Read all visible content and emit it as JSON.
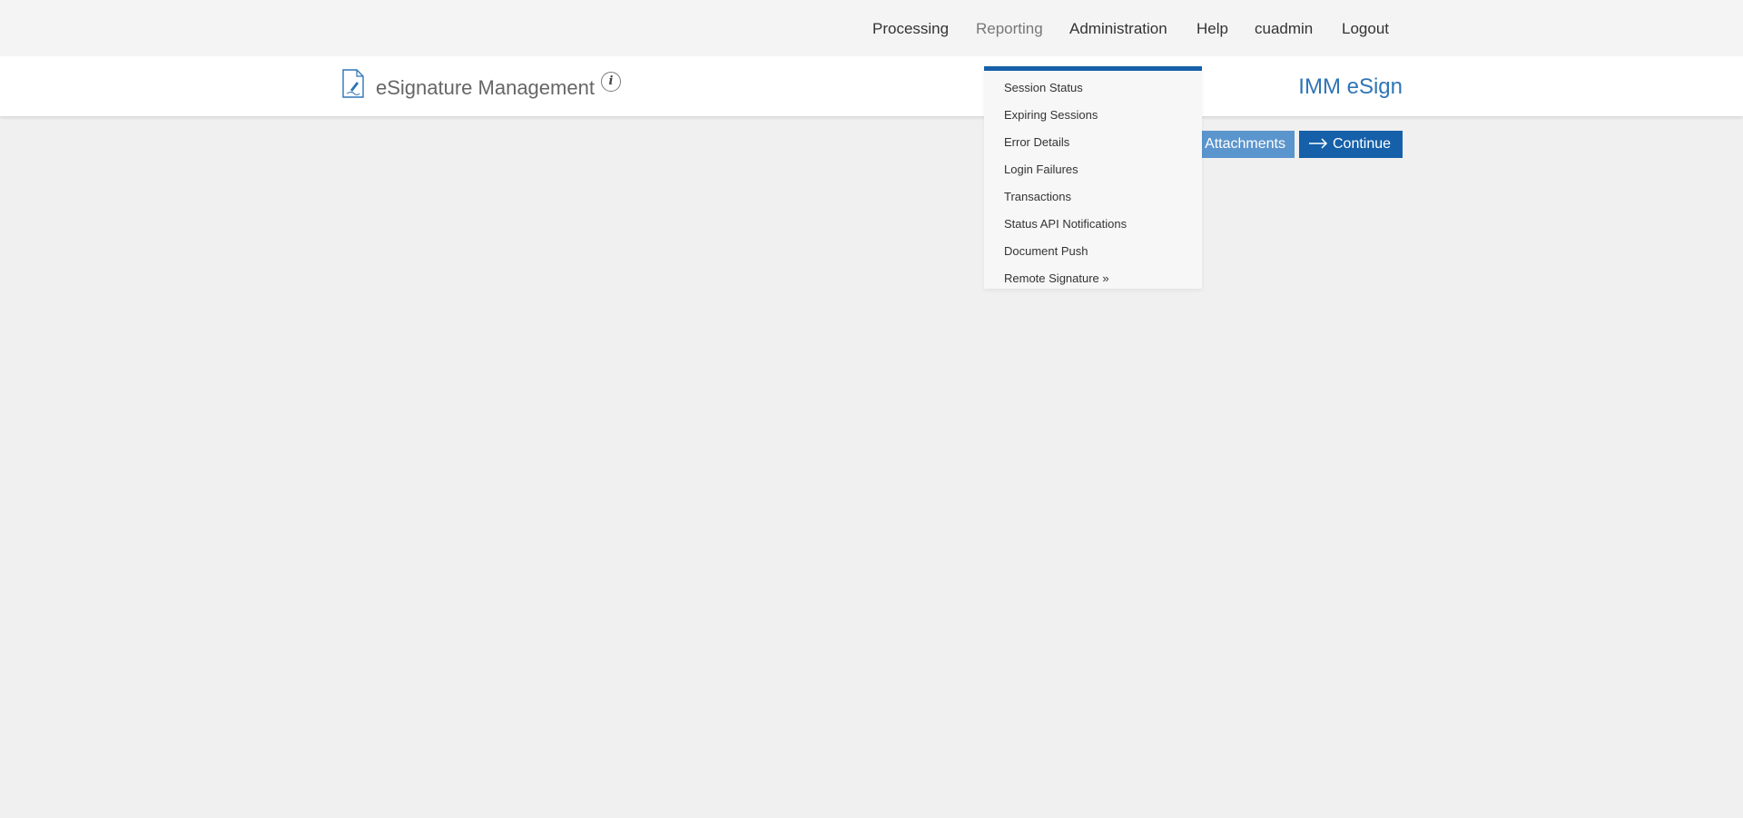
{
  "topnav": {
    "items": [
      {
        "label": "Processing"
      },
      {
        "label": "Reporting"
      },
      {
        "label": "Administration"
      },
      {
        "label": "Help"
      },
      {
        "label": "cuadmin"
      },
      {
        "label": "Logout"
      }
    ],
    "active": "Reporting"
  },
  "header": {
    "title": "eSignature Management",
    "info_symbol": "i",
    "brand": "IMM eSign"
  },
  "actions": {
    "attachments_label": "Attachments",
    "continue_label": "Continue"
  },
  "reporting_menu": {
    "items": [
      {
        "label": "Session Status"
      },
      {
        "label": "Expiring Sessions"
      },
      {
        "label": "Error Details"
      },
      {
        "label": "Login Failures"
      },
      {
        "label": "Transactions"
      },
      {
        "label": "Status API Notifications"
      },
      {
        "label": "Document Push"
      },
      {
        "label": "Remote Signature »"
      }
    ]
  },
  "colors": {
    "accent": "#1560a8",
    "accent_light": "#5b95cd",
    "brand_text": "#2e75b6",
    "background": "#f0f0f0"
  },
  "icons": {
    "document": "document-signature-icon",
    "info": "info-icon",
    "continue": "arrow-right-icon"
  }
}
